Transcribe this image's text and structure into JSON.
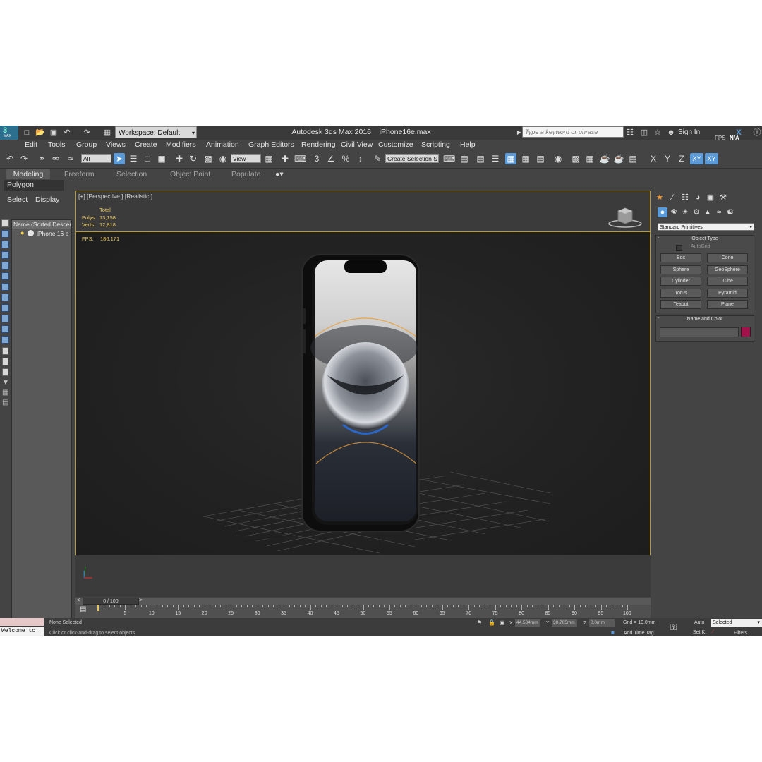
{
  "titlebar": {
    "workspace": "Workspace: Default",
    "app_name": "Autodesk 3ds Max 2016",
    "file_name": "iPhone16e.max",
    "search_placeholder": "Type a keyword or phrase",
    "sign_in": "Sign In",
    "fps_label": "FPS",
    "fps_value": "N/A",
    "logo_text": "MAX"
  },
  "menu": [
    "Edit",
    "Tools",
    "Group",
    "Views",
    "Create",
    "Modifiers",
    "Animation",
    "Graph Editors",
    "Rendering",
    "Civil View",
    "Customize",
    "Scripting",
    "Help"
  ],
  "toolbar": {
    "filter": "All",
    "ref_coord": "View",
    "named_sel": "Create Selection S",
    "axes": [
      "X",
      "Y",
      "Z",
      "XY",
      "XY"
    ]
  },
  "ribbon": {
    "tabs": [
      "Modeling",
      "Freeform",
      "Selection",
      "Object Paint",
      "Populate"
    ],
    "panel": "Polygon Modeling"
  },
  "explorer": {
    "tabs": [
      "Select",
      "Display"
    ],
    "column_header": "Name (Sorted Descenc",
    "item": "iPhone 16 e"
  },
  "viewport": {
    "label": "[+] [Perspective ] [Realistic ]",
    "stats_header": "Total",
    "polys_label": "Polys:",
    "polys_value": "13,158",
    "verts_label": "Verts:",
    "verts_value": "12,818",
    "fps_label": "FPS:",
    "fps_value": "186.171"
  },
  "command_panel": {
    "dropdown": "Standard Primitives",
    "object_type": "Object Type",
    "autogrid": "AutoGrid",
    "buttons": [
      "Box",
      "Cone",
      "Sphere",
      "GeoSphere",
      "Cylinder",
      "Tube",
      "Torus",
      "Pyramid",
      "Teapot",
      "Plane"
    ],
    "name_color": "Name and Color",
    "color_swatch": "#a3124a"
  },
  "timeline": {
    "frame": "0 / 100",
    "ticks": [
      "5",
      "10",
      "15",
      "20",
      "25",
      "30",
      "35",
      "40",
      "45",
      "50",
      "55",
      "60",
      "65",
      "70",
      "75",
      "80",
      "85",
      "90",
      "95",
      "100"
    ]
  },
  "status": {
    "listener": "Welcome tc",
    "selection": "None Selected",
    "prompt": "Click or click-and-drag to select objects",
    "x_label": "X:",
    "x_value": "44.504mm",
    "y_label": "Y:",
    "y_value": "30.765mm",
    "z_label": "Z:",
    "z_value": "0.0mm",
    "grid": "Grid = 10.0mm",
    "add_time_tag": "Add Time Tag",
    "auto": "Auto",
    "set_key": "Set K.",
    "selected": "Selected",
    "filters": "Filters..."
  }
}
